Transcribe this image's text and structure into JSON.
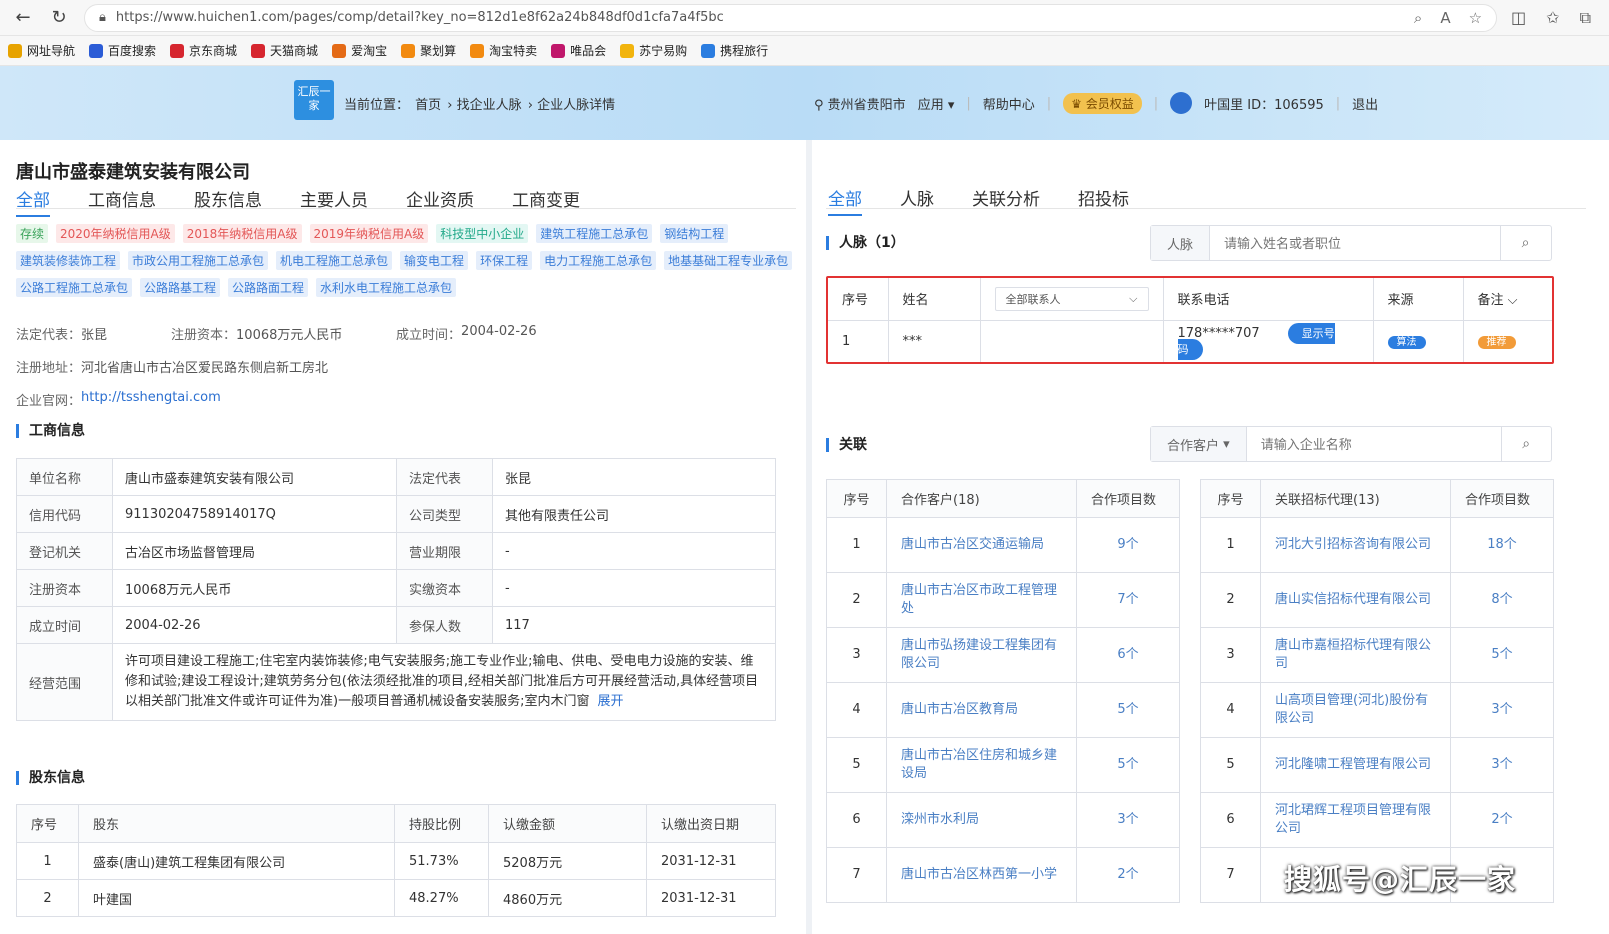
{
  "browser": {
    "url": "https://www.huichen1.com/pages/comp/detail?key_no=812d1e8f62a24b848df0d1cfa7a4f5bc",
    "bookmarks": [
      "网址导航",
      "百度搜索",
      "京东商城",
      "天猫商城",
      "爱淘宝",
      "聚划算",
      "淘宝特卖",
      "唯品会",
      "苏宁易购",
      "携程旅行"
    ]
  },
  "header": {
    "logo_text": "汇辰一家",
    "crumb_prefix": "当前位置：",
    "crumb_home": "首页",
    "crumb_mid": "找企业人脉",
    "crumb_end": "企业人脉详情",
    "location": "贵州省贵阳市",
    "apps": "应用",
    "help": "帮助中心",
    "vip": "会员权益",
    "user": "叶国里 ID：106595",
    "logout": "退出"
  },
  "company": {
    "name": "唐山市盛泰建筑安装有限公司",
    "tabs": [
      "全部",
      "工商信息",
      "股东信息",
      "主要人员",
      "企业资质",
      "工商变更"
    ],
    "tags": [
      {
        "text": "存续",
        "color": "green"
      },
      {
        "text": "2020年纳税信用A级",
        "color": "red"
      },
      {
        "text": "2018年纳税信用A级",
        "color": "red"
      },
      {
        "text": "2019年纳税信用A级",
        "color": "red"
      },
      {
        "text": "科技型中小企业",
        "color": "teal"
      },
      {
        "text": "建筑工程施工总承包",
        "color": "blue"
      },
      {
        "text": "钢结构工程",
        "color": "blue"
      },
      {
        "text": "建筑装修装饰工程",
        "color": "blue"
      },
      {
        "text": "市政公用工程施工总承包",
        "color": "blue"
      },
      {
        "text": "机电工程施工总承包",
        "color": "blue"
      },
      {
        "text": "输变电工程",
        "color": "blue"
      },
      {
        "text": "环保工程",
        "color": "blue"
      },
      {
        "text": "电力工程施工总承包",
        "color": "blue"
      },
      {
        "text": "地基基础工程专业承包",
        "color": "blue"
      },
      {
        "text": "公路工程施工总承包",
        "color": "blue"
      },
      {
        "text": "公路路基工程",
        "color": "blue"
      },
      {
        "text": "公路路面工程",
        "color": "blue"
      },
      {
        "text": "水利水电工程施工总承包",
        "color": "blue"
      }
    ],
    "legal_rep_label": "法定代表：",
    "legal_rep": "张昆",
    "capital_label": "注册资本：",
    "capital": "10068万元人民币",
    "founded_label": "成立时间：",
    "founded": "2004-02-26",
    "address_label": "注册地址：",
    "address": "河北省唐山市古冶区爱民路东侧启新工房北",
    "website_label": "企业官网：",
    "website": "http://tsshengtai.com"
  },
  "biz_info": {
    "title": "工商信息",
    "rows": [
      [
        "单位名称",
        "唐山市盛泰建筑安装有限公司",
        "法定代表",
        "张昆"
      ],
      [
        "信用代码",
        "91130204758914017Q",
        "公司类型",
        "其他有限责任公司"
      ],
      [
        "登记机关",
        "古冶区市场监督管理局",
        "营业期限",
        "-"
      ],
      [
        "注册资本",
        "10068万元人民币",
        "实缴资本",
        "-"
      ],
      [
        "成立时间",
        "2004-02-26",
        "参保人数",
        "117"
      ]
    ],
    "scope_label": "经营范围",
    "scope": "许可项目建设工程施工;住宅室内装饰装修;电气安装服务;施工专业作业;输电、供电、受电电力设施的安装、维修和试验;建设工程设计;建筑劳务分包(依法须经批准的项目,经相关部门批准后方可开展经营活动,具体经营项目以相关部门批准文件或许可证件为准)一般项目普通机械设备安装服务;室内木门窗",
    "expand": "展开"
  },
  "shareholders": {
    "title": "股东信息",
    "headers": [
      "序号",
      "股东",
      "持股比例",
      "认缴金额",
      "认缴出资日期"
    ],
    "rows": [
      [
        "1",
        "盛泰(唐山)建筑工程集团有限公司",
        "51.73%",
        "5208万元",
        "2031-12-31"
      ],
      [
        "2",
        "叶建国",
        "48.27%",
        "4860万元",
        "2031-12-31"
      ]
    ]
  },
  "right": {
    "tabs": [
      "全部",
      "人脉",
      "关联分析",
      "招投标"
    ],
    "contacts_title": "人脉（1）",
    "contacts_search_prefix": "人脉",
    "contacts_search_placeholder": "请输入姓名或者职位",
    "contact_headers": {
      "idx": "序号",
      "name": "姓名",
      "select": "全部联系人",
      "phone": "联系电话",
      "source": "来源",
      "note": "备注"
    },
    "contact_row": {
      "idx": "1",
      "name": "***",
      "phone": "178*****707",
      "show_btn": "显示号码",
      "source": "算法",
      "note": "推荐"
    },
    "rel_title": "关联",
    "rel_search_prefix": "合作客户",
    "rel_search_placeholder": "请输入企业名称",
    "clients_headers": [
      "序号",
      "合作客户(18)",
      "合作项目数"
    ],
    "clients": [
      [
        "1",
        "唐山市古冶区交通运输局",
        "9个"
      ],
      [
        "2",
        "唐山市古冶区市政工程管理处",
        "7个"
      ],
      [
        "3",
        "唐山市弘扬建设工程集团有限公司",
        "6个"
      ],
      [
        "4",
        "唐山市古冶区教育局",
        "5个"
      ],
      [
        "5",
        "唐山市古冶区住房和城乡建设局",
        "5个"
      ],
      [
        "6",
        "滦州市水利局",
        "3个"
      ],
      [
        "7",
        "唐山市古冶区林西第一小学",
        "2个"
      ]
    ],
    "agents_headers": [
      "序号",
      "关联招标代理(13)",
      "合作项目数"
    ],
    "agents": [
      [
        "1",
        "河北大引招标咨询有限公司",
        "18个"
      ],
      [
        "2",
        "唐山实信招标代理有限公司",
        "8个"
      ],
      [
        "3",
        "唐山市嘉桓招标代理有限公司",
        "5个"
      ],
      [
        "4",
        "山高项目管理(河北)股份有限公司",
        "3个"
      ],
      [
        "5",
        "河北隆啸工程管理有限公司",
        "3个"
      ],
      [
        "6",
        "河北珺辉工程项目管理有限公司",
        "2个"
      ],
      [
        "7",
        "",
        ""
      ]
    ]
  },
  "watermark": "搜狐号@汇辰一家"
}
